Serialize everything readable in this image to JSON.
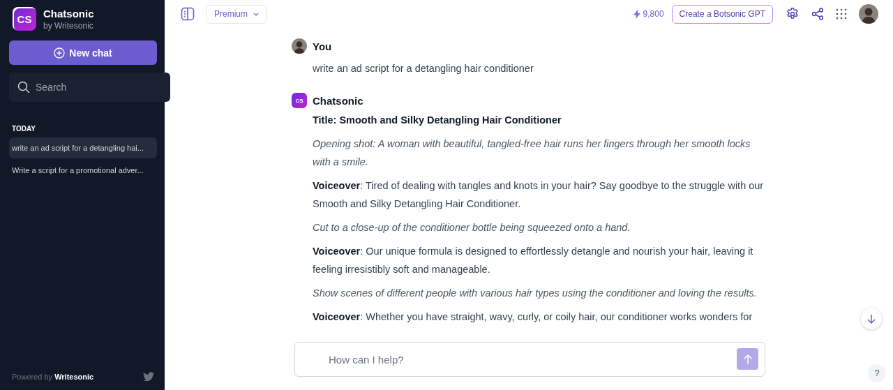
{
  "sidebar": {
    "app_name": "Chatsonic",
    "app_byline": "by Writesonic",
    "logo_text": "CS",
    "new_chat_label": "New chat",
    "search": {
      "placeholder": "Search"
    },
    "section_heading": "TODAY",
    "history": [
      {
        "title": "write an ad script for a detangling hai...",
        "selected": true
      },
      {
        "title": "Write a script for a promotional adver...",
        "selected": false
      }
    ],
    "footer": {
      "powered_by": "Powered by",
      "brand": "Writesonic"
    }
  },
  "header": {
    "plan": "Premium",
    "credits": "9,800",
    "create_button": "Create a Botsonic GPT"
  },
  "messages": [
    {
      "author": "You",
      "kind": "user",
      "paragraphs": [
        {
          "kind": "plain",
          "text": "write an ad script for a detangling hair conditioner"
        }
      ]
    },
    {
      "author": "Chatsonic",
      "kind": "bot",
      "avatar_text": "CS",
      "paragraphs": [
        {
          "kind": "title",
          "text": "Title: Smooth and Silky Detangling Hair Conditioner"
        },
        {
          "kind": "direction",
          "text": "Opening shot: A woman with beautiful, tangled-free hair runs her fingers through her smooth locks with a smile."
        },
        {
          "kind": "plain",
          "text": "**Voiceover**: Tired of dealing with tangles and knots in your hair? Say goodbye to the struggle with our Smooth and Silky Detangling Hair Conditioner."
        },
        {
          "kind": "direction",
          "text": "Cut to a close-up of the conditioner bottle being squeezed onto a hand."
        },
        {
          "kind": "plain",
          "text": "**Voiceover**: Our unique formula is designed to effortlessly detangle and nourish your hair, leaving it feeling irresistibly soft and manageable."
        },
        {
          "kind": "direction",
          "text": "Show scenes of different people with various hair types using the conditioner and loving the results."
        },
        {
          "kind": "plain",
          "text": "**Voiceover**: Whether you have straight, wavy, curly, or coily hair, our conditioner works wonders for"
        }
      ]
    }
  ],
  "composer": {
    "placeholder": "How can I help?"
  },
  "help_label": "?"
}
